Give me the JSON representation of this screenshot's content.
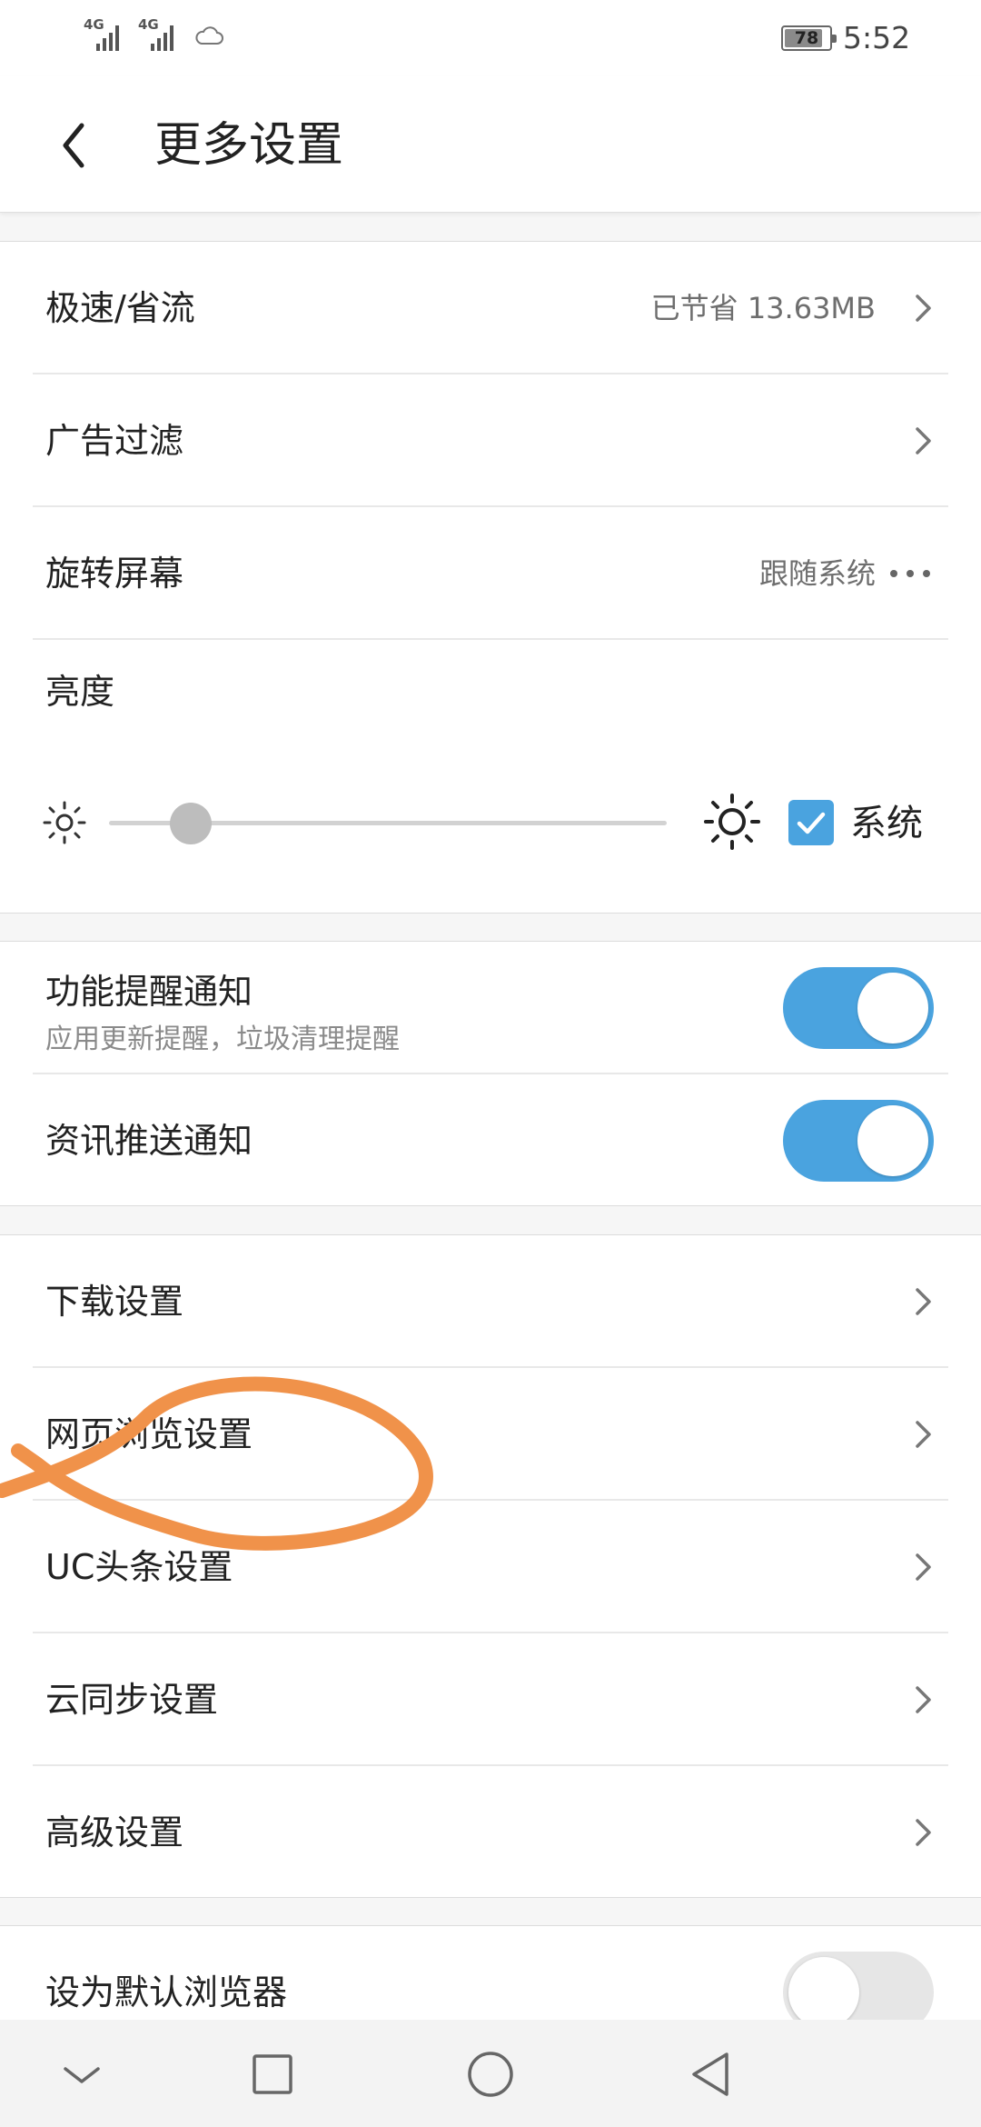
{
  "status_bar": {
    "network_1": "4G",
    "network_2": "4G",
    "battery": "78",
    "time": "5:52"
  },
  "header": {
    "title": "更多设置"
  },
  "section1": {
    "speed": {
      "label": "极速/省流",
      "value": "已节省 13.63MB"
    },
    "adblock": {
      "label": "广告过滤"
    },
    "rotate": {
      "label": "旋转屏幕",
      "value": "跟随系统"
    },
    "brightness": {
      "label": "亮度",
      "system_label": "系统",
      "system_checked": true,
      "level": 0.15
    }
  },
  "section2": {
    "feature_notify": {
      "label": "功能提醒通知",
      "sub": "应用更新提醒，垃圾清理提醒",
      "on": true
    },
    "news_notify": {
      "label": "资讯推送通知",
      "on": true
    }
  },
  "section3": {
    "items": [
      "下载设置",
      "网页浏览设置",
      "UC头条设置",
      "云同步设置",
      "高级设置"
    ]
  },
  "section4": {
    "default_browser": {
      "label": "设为默认浏览器",
      "on": false
    }
  },
  "colors": {
    "accent": "#4aa3df",
    "annotation": "#f0924a"
  }
}
